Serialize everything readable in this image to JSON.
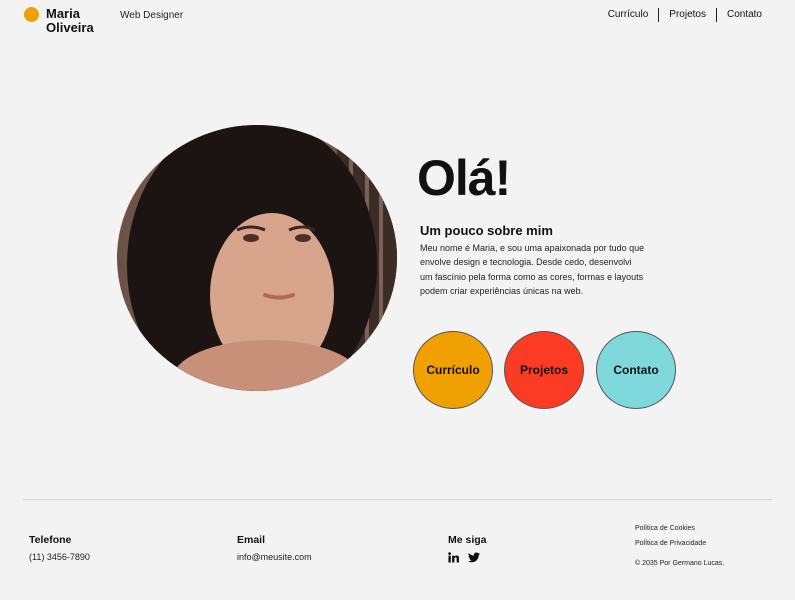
{
  "header": {
    "brand_name": "Maria Oliveira",
    "brand_role": "Web Designer",
    "nav": [
      "Currículo",
      "Projetos",
      "Contato"
    ]
  },
  "hero": {
    "greeting": "Olá!",
    "about_title": "Um pouco sobre mim",
    "about_text": "Meu nome é Maria, e sou uma apaixonada por tudo que envolve design e tecnologia. Desde cedo, desenvolvi um fascínio pela forma como as cores, formas e layouts podem criar experiências únicas na web.",
    "buttons": [
      "Currículo",
      "Projetos",
      "Contato"
    ]
  },
  "footer": {
    "phone_title": "Telefone",
    "phone": "(11) 3456-7890",
    "email_title": "Email",
    "email": "info@meusite.com",
    "social_title": "Me siga",
    "social_icons": [
      "linkedin-icon",
      "twitter-icon"
    ],
    "cookies": "Política de Cookies",
    "privacy": "Política de Privacidade",
    "copyright": "© 2035 Por Germano Lucas."
  },
  "colors": {
    "accent_orange": "#f0a000",
    "accent_red": "#fb3b23",
    "accent_teal": "#7fd8dc",
    "background": "#f3f3f3"
  }
}
